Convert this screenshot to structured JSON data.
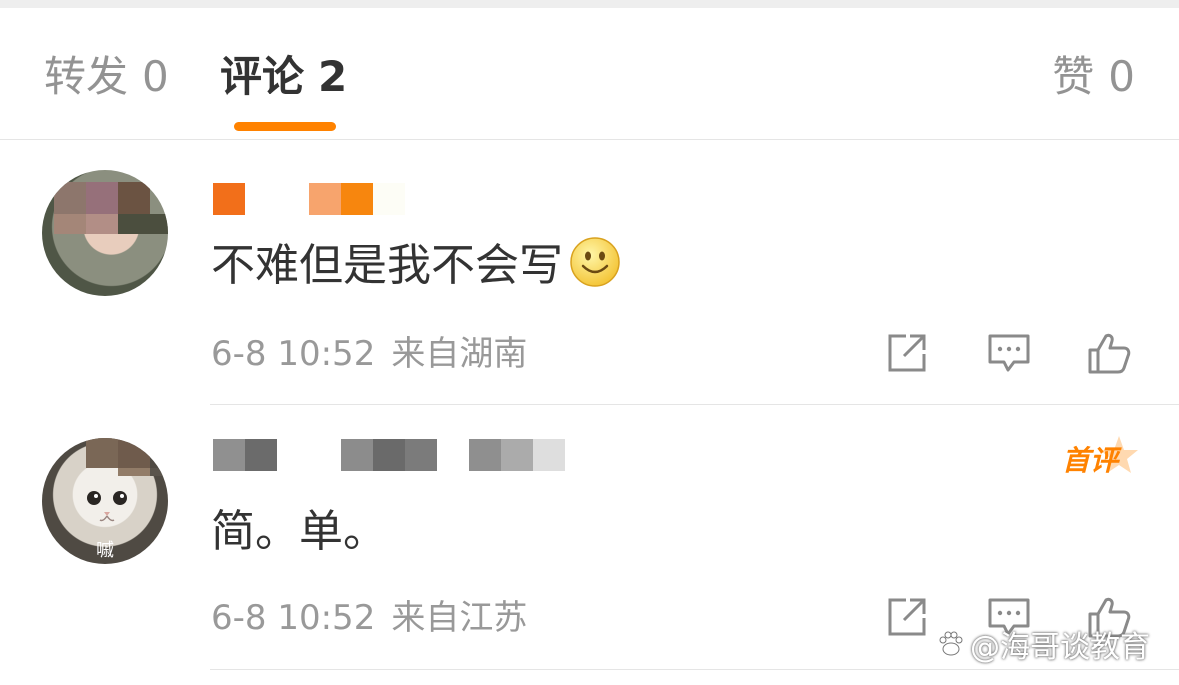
{
  "tabs": {
    "repost": {
      "label": "转发",
      "count": "0"
    },
    "comments": {
      "label": "评论",
      "count": "2"
    },
    "likes": {
      "label": "赞",
      "count": "0"
    }
  },
  "colors": {
    "accent": "#ff8200",
    "text": "#333333",
    "muted": "#999999"
  },
  "comments": [
    {
      "text": "不难但是我不会写",
      "emoji": "smile-icon",
      "time": "6-8 10:52",
      "location": "来自湖南",
      "first_badge": ""
    },
    {
      "avatar_caption": "嘁",
      "text": "简。单。",
      "time": "6-8 10:52",
      "location": "来自江苏",
      "first_badge": "首评"
    }
  ],
  "watermark": {
    "text": "@海哥谈教育",
    "icon": "paw-icon"
  }
}
